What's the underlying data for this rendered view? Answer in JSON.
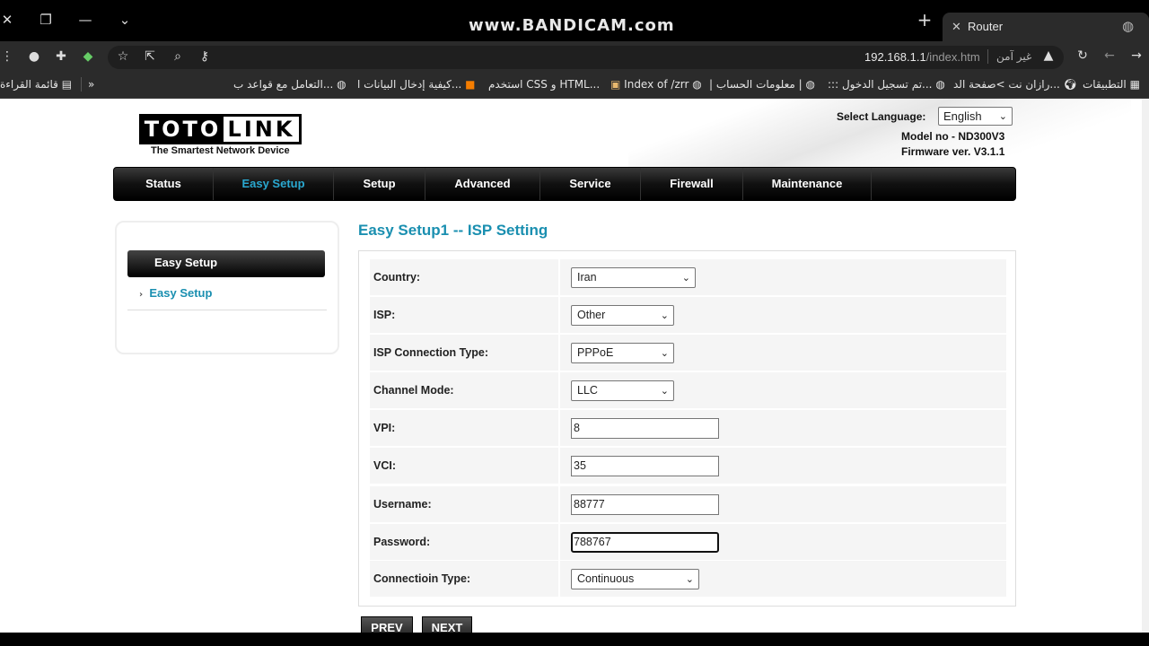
{
  "browser": {
    "watermark": "www.BANDICAM.com",
    "tab_title": "Router",
    "url_host": "192.168.1.1",
    "url_path": "/index.htm",
    "security_label": "غير آمن",
    "bookmarks": [
      "التطبيقات",
      "رازان نت >صفحة الد...",
      "::: تم تسجيل الدخول...",
      "| معلومات الحساب |",
      "Index of /zrr",
      "استخدم CSS و HTML...",
      "كيفية إدخال البيانات ا...",
      "التعامل مع قواعد ب...",
      "»",
      "قائمة القراءة"
    ]
  },
  "header": {
    "logo_left": "TOTO",
    "logo_right": "LINK",
    "tagline": "The Smartest Network Device",
    "select_language_label": "Select Language:",
    "language_value": "English",
    "model": "Model no - ND300V3",
    "firmware": "Firmware ver. V3.1.1"
  },
  "nav": [
    "Status",
    "Easy Setup",
    "Setup",
    "Advanced",
    "Service",
    "Firewall",
    "Maintenance"
  ],
  "sidebar": {
    "heading": "Easy Setup",
    "link": "Easy Setup"
  },
  "main": {
    "title": "Easy Setup1 -- ISP Setting",
    "fields": {
      "country": {
        "label": "Country:",
        "value": "Iran"
      },
      "isp": {
        "label": "ISP:",
        "value": "Other"
      },
      "conn_type": {
        "label": "ISP Connection Type:",
        "value": "PPPoE"
      },
      "channel": {
        "label": "Channel Mode:",
        "value": "LLC"
      },
      "vpi": {
        "label": "VPI:",
        "value": "8"
      },
      "vci": {
        "label": "VCI:",
        "value": "35"
      },
      "username": {
        "label": "Username:",
        "value": "88777"
      },
      "password": {
        "label": "Password:",
        "value": "788767"
      },
      "connection": {
        "label": "Connectioin Type:",
        "value": "Continuous"
      }
    },
    "prev": "PREV",
    "next": "NEXT"
  },
  "colors": {
    "accent": "#1a8fb0",
    "nav_bg": "#000000"
  }
}
